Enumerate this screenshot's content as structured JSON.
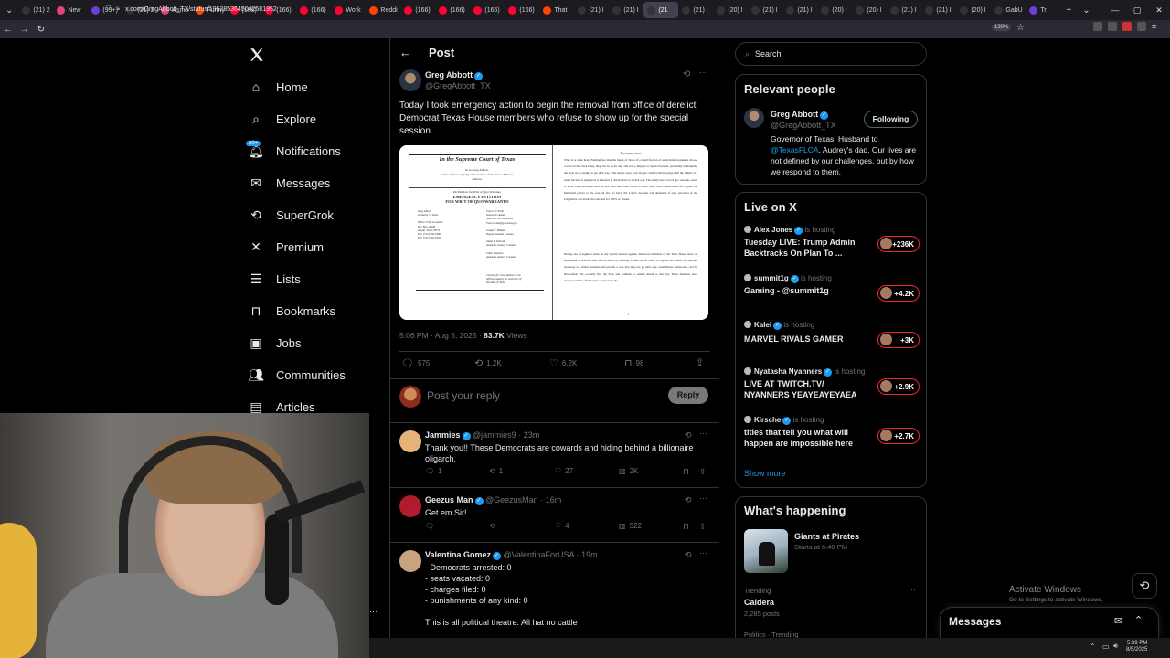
{
  "browser": {
    "tabs": [
      {
        "label": "(21) 2",
        "color": "#333"
      },
      {
        "label": "New",
        "color": "#e0457b"
      },
      {
        "label": "(99+)",
        "color": "#6a3fd6"
      },
      {
        "label": "(21) 2",
        "color": "#333"
      },
      {
        "label": "Asmo",
        "color": "#e0457b"
      },
      {
        "label": "Funny",
        "color": "#ff4500"
      },
      {
        "label": "(166)",
        "color": "#ff0033"
      },
      {
        "label": "(166)",
        "color": "#ff0033"
      },
      {
        "label": "(166)",
        "color": "#ff0033"
      },
      {
        "label": "Work",
        "color": "#ff0033"
      },
      {
        "label": "Reddi",
        "color": "#ff4500"
      },
      {
        "label": "(166)",
        "color": "#ff0033"
      },
      {
        "label": "(166)",
        "color": "#ff0033"
      },
      {
        "label": "(166)",
        "color": "#ff0033"
      },
      {
        "label": "(166)",
        "color": "#ff0033"
      },
      {
        "label": "That",
        "color": "#ff4500"
      },
      {
        "label": "(21) I",
        "color": "#333"
      },
      {
        "label": "(21) I",
        "color": "#333"
      },
      {
        "label": "(21",
        "color": "#333",
        "active": true
      },
      {
        "label": "(21) I",
        "color": "#333"
      },
      {
        "label": "(20) I",
        "color": "#333"
      },
      {
        "label": "(21) I",
        "color": "#333"
      },
      {
        "label": "(21) I",
        "color": "#333"
      },
      {
        "label": "(20) I",
        "color": "#333"
      },
      {
        "label": "(20) I",
        "color": "#333"
      },
      {
        "label": "(21) I",
        "color": "#333"
      },
      {
        "label": "(21) I",
        "color": "#333"
      },
      {
        "label": "(20) I",
        "color": "#333"
      },
      {
        "label": "GabU",
        "color": "#333"
      },
      {
        "label": "Tr",
        "color": "#6a3fd6"
      }
    ],
    "url": "x.com/GregAbbott_TX/status/1952853645042581952",
    "zoom": "120%"
  },
  "nav": {
    "items": [
      {
        "label": "Home",
        "icon": "home-icon"
      },
      {
        "label": "Explore",
        "icon": "search-icon"
      },
      {
        "label": "Notifications",
        "icon": "bell-icon"
      },
      {
        "label": "Messages",
        "icon": "mail-icon"
      },
      {
        "label": "SuperGrok",
        "icon": "grok-icon"
      },
      {
        "label": "Premium",
        "icon": "x-logo-icon"
      },
      {
        "label": "Lists",
        "icon": "list-icon"
      },
      {
        "label": "Bookmarks",
        "icon": "bookmark-icon"
      },
      {
        "label": "Jobs",
        "icon": "briefcase-icon"
      },
      {
        "label": "Communities",
        "icon": "people-icon"
      },
      {
        "label": "Articles",
        "icon": "article-icon"
      }
    ],
    "notif_badge": "20+"
  },
  "post": {
    "header": "Post",
    "author_name": "Greg Abbott",
    "author_handle": "@GregAbbott_TX",
    "text": "Today I took emergency action to begin the removal from office of derelict Democrat Texas House members who refuse to show up for the special session.",
    "doc_left": {
      "court": "In the Supreme Court of Texas",
      "lines1": [
        "In re Greg Abbott,",
        "in his official capacity as Governor of the State of Texas,",
        "Relator."
      ],
      "petition": "On Petition for Writ of Quo Warranto",
      "title1": "EMERGENCY PETITION",
      "title2": "FOR WRIT OF QUO WARRANTO",
      "left_block": [
        "Greg Abbott",
        "Governor of Texas",
        "",
        "Office of the Governor",
        "P.O. Box 12428",
        "Austin, Texas 78711",
        "Tel.: (512) 936-3306",
        "Fax: (512) 463-1932"
      ],
      "right_block": [
        "Trevor W. Ezell",
        "General Counsel",
        "State Bar No. 24109849",
        "Trevor.Ezell@gov.texas.gov",
        "",
        "Joseph F. Behnke",
        "Deputy General Counsel",
        "",
        "Jamie T. Zaborek",
        "Assistant General Counsel",
        "",
        "Caleb Guerrera",
        "Assistant General Counsel"
      ],
      "counsel": [
        "Counsel for Greg Abbott, in his",
        "official capacity as Governor of",
        "the State of Texas"
      ]
    },
    "doc_right": {
      "heading": "Introduction",
      "p1": "What is at stake here? Nothing less than the future of Texas. If a small fraction of recalcitrant lawmakers choose to run out the clock today, they can do so for any, and every, Regular or Special Session, potentially bankrupting the State in an attempt to get their way. That means every state budget could be held hostage until the whims of a small fraction of legislators is satisfied. It doesn't have to be that way. The timely need writ of quo warranto exists to solve exact problems such as this. And this Court exists to solve cases with ramifications far beyond the individual parties to the case. In fact we have, the Court's decision will determine if only one-third of the Legislature can dictate the outcome for 100% of Texans.",
      "p2": "During one of eighteen items on the Special Session agenda, Democrat members of the Texas House show an entitlement to abdicate their official duties by refusing to show up for work. To deprive the House of a quorum necessary to conduct business and prevent a vote that may not go their way, some House Democrats—led by Respondent Wu—recently fled the State and continue to remain absent to this day. These members have abandoned their official duties required by the",
      "page_num": "1"
    },
    "timestamp": "5:06 PM · Aug 5, 2025 · ",
    "views_count": "83.7K",
    "views_label": " Views",
    "stats": {
      "replies": "575",
      "reposts": "1.2K",
      "likes": "6.2K",
      "bookmarks": "98"
    },
    "reply_placeholder": "Post your reply",
    "reply_button": "Reply"
  },
  "replies": [
    {
      "name": "Jammies",
      "handle": "@jammies9",
      "time": "· 23m",
      "text": "Thank you!! These Democrats are cowards and hiding behind a billionaire oligarch.",
      "replies": "1",
      "reposts": "1",
      "likes": "27",
      "views": "2K",
      "avatar": "#e7b27a"
    },
    {
      "name": "Geezus Man",
      "handle": "@GeezusMan",
      "time": "· 16m",
      "text": "Get em Sir!",
      "replies": "",
      "reposts": "",
      "likes": "4",
      "views": "522",
      "avatar": "#b01c2e"
    },
    {
      "name": "Valentina Gomez",
      "handle": "@ValentinaForUSA",
      "time": "· 19m",
      "lines": [
        "- Democrats arrested: 0",
        "- seats vacated: 0",
        "- charges filed: 0",
        "- punishments of any kind: 0",
        "",
        "This is all political theatre. All hat no cattle"
      ],
      "avatar": "#c9a27e"
    }
  ],
  "right": {
    "search_placeholder": "Search",
    "relevant_title": "Relevant people",
    "rp_name": "Greg Abbott",
    "rp_handle": "@GregAbbott_TX",
    "rp_follow": "Following",
    "rp_bio_1": "Governor of Texas. Husband to ",
    "rp_bio_link": "@TexasFLCA",
    "rp_bio_2": ". Audrey's dad. Our lives are not defined by our challenges, but by how we respond to them.",
    "live_title": "Live on X",
    "live": [
      {
        "host": "Alex Jones",
        "status": "is hosting",
        "title": "Tuesday LIVE: Trump Admin Backtracks On Plan To ...",
        "count": "+236K"
      },
      {
        "host": "summit1g",
        "status": "is hosting",
        "title": "Gaming - @summit1g",
        "count": "+4.2K"
      },
      {
        "host": "Kalei",
        "status": "is hosting",
        "title": "MARVEL RIVALS GAMER",
        "count": "+3K"
      },
      {
        "host": "Nyatasha Nyanners",
        "status": "is hosting",
        "title": "LIVE AT TWITCH.TV/ NYANNERS YEAYEAYEYAEA",
        "count": "+2.9K"
      },
      {
        "host": "Kirsche",
        "status": "is hosting",
        "title": "titles that tell you what will happen are impossible here",
        "count": "+2.7K"
      }
    ],
    "show_more": "Show more",
    "happening_title": "What's happening",
    "event_name": "Giants at Pirates",
    "event_time": "Starts at 6:40 PM",
    "trend_label": "Trending",
    "trend_name": "Caldera",
    "trend_posts": "2,285 posts",
    "trend_next": "Politics · Trending"
  },
  "overlay": {
    "activate_title": "Activate Windows",
    "activate_sub": "Go to Settings to activate Windows.",
    "messages": "Messages"
  },
  "taskbar": {
    "time": "5:39 PM",
    "date": "8/5/2025"
  }
}
